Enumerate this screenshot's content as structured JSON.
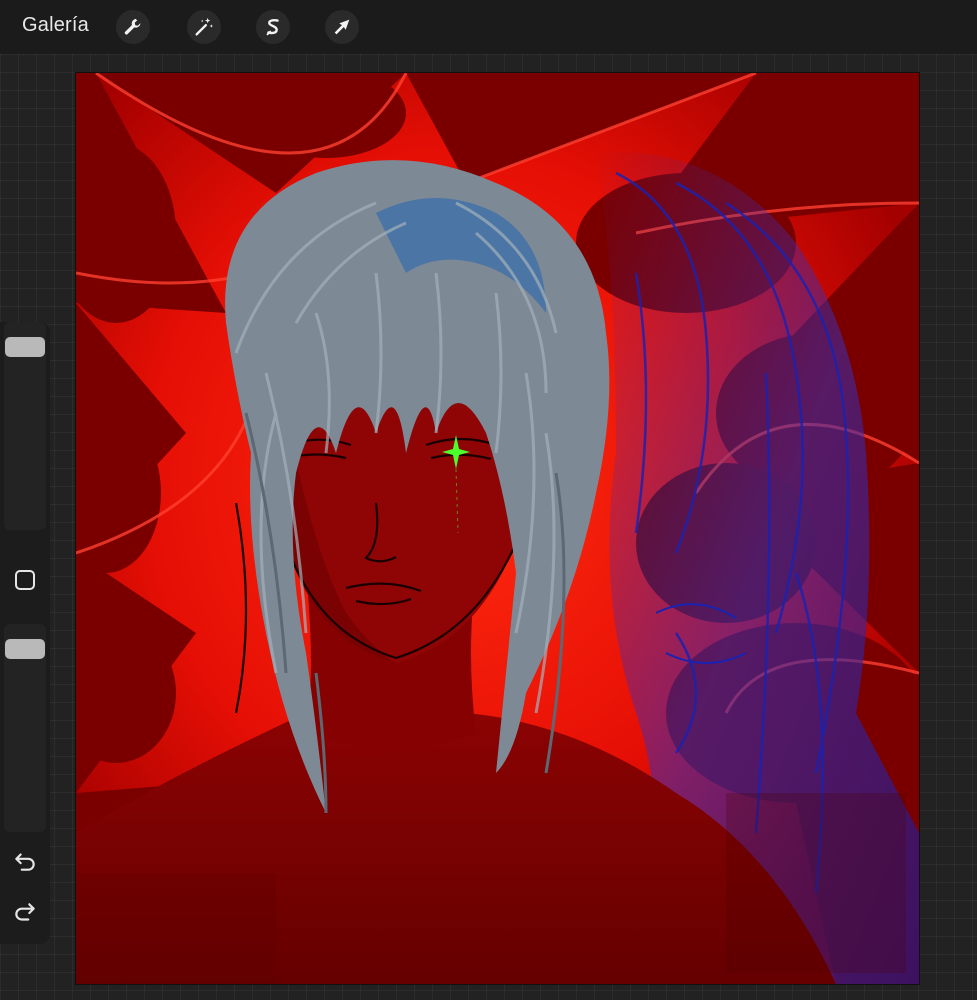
{
  "topbar": {
    "gallery_label": "Galería",
    "tools": [
      {
        "icon": "wrench-icon",
        "action": "actions"
      },
      {
        "icon": "magic-wand-icon",
        "action": "adjustments"
      },
      {
        "icon": "selection-s-icon",
        "action": "selection"
      },
      {
        "icon": "arrow-cursor-icon",
        "action": "transform"
      }
    ]
  },
  "sidebar": {
    "brush_size_level": 0.05,
    "opacity_level": 0.05,
    "modify_icon": "square-icon",
    "undo_icon": "undo-icon",
    "redo_icon": "redo-icon"
  },
  "colors": {
    "background_red": "#7a0000",
    "bright_red": "#ff1a0a",
    "hair_gray": "#7d8a96",
    "hair_blue": "#3f6fa8",
    "sketch_blue": "#1a22b0",
    "star_green": "#4cff2b"
  }
}
